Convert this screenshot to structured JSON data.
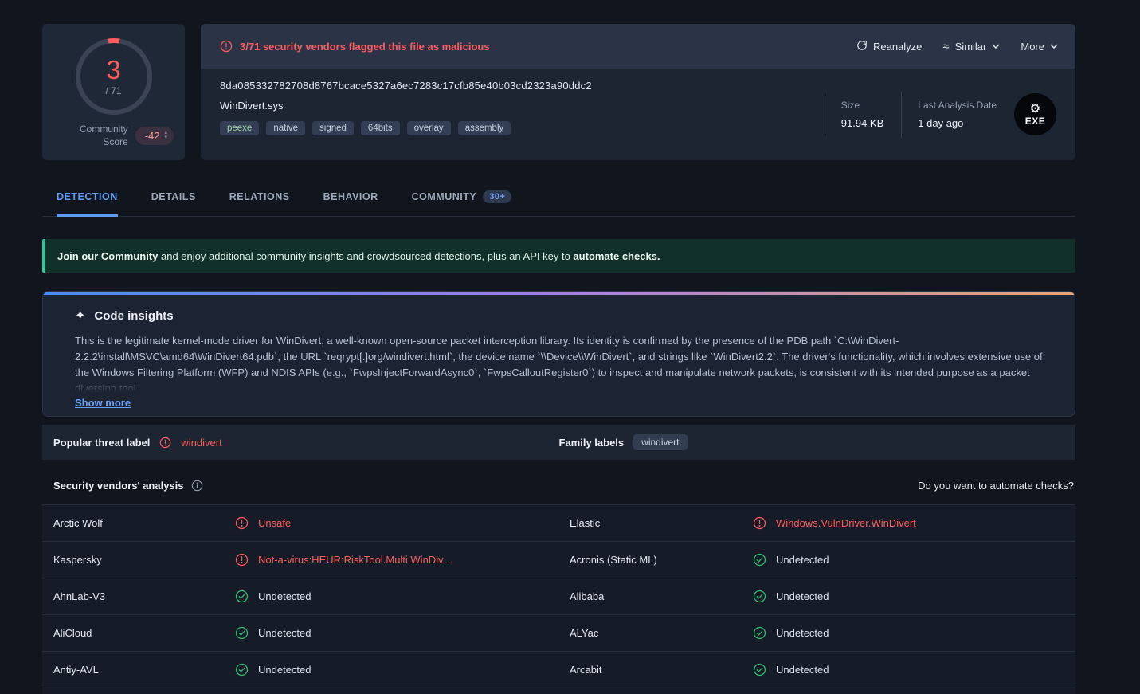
{
  "colors": {
    "red": "#ff5c5c",
    "green": "#2fbf71",
    "blue": "#619bf2",
    "teal": "#2ec89b",
    "tag-green": "#9fd6ad"
  },
  "score_widget": {
    "score": "3",
    "total": "/ 71",
    "community_label": "Community Score",
    "community_value": "-42"
  },
  "header": {
    "flag_message": "3/71 security vendors flagged this file as malicious",
    "reanalyze": "Reanalyze",
    "similar": "Similar",
    "more": "More",
    "hash": "8da085332782708d8767bcace5327a6ec7283c17cfb85e40b03cd2323a90ddc2",
    "filename": "WinDivert.sys",
    "tags": {
      "0": "peexe",
      "1": "native",
      "2": "signed",
      "3": "64bits",
      "4": "overlay",
      "5": "assembly"
    },
    "size_label": "Size",
    "size_value": "91.94 KB",
    "date_label": "Last Analysis Date",
    "date_value": "1 day ago",
    "filetype": "EXE"
  },
  "tabs": {
    "0": {
      "label": "DETECTION"
    },
    "1": {
      "label": "DETAILS"
    },
    "2": {
      "label": "RELATIONS"
    },
    "3": {
      "label": "BEHAVIOR"
    },
    "4": {
      "label": "COMMUNITY",
      "badge": "30+"
    }
  },
  "community_banner": {
    "link1": "Join our Community",
    "middle": " and enjoy additional community insights and crowdsourced detections, plus an API key to ",
    "link2": "automate checks."
  },
  "code_insights": {
    "title": "Code insights",
    "body": "This is the legitimate kernel-mode driver for WinDivert, a well-known open-source packet interception library. Its identity is confirmed by the presence of the PDB path `C:\\WinDivert-2.2.2\\install\\MSVC\\amd64\\WinDivert64.pdb`, the URL `reqrypt[.]org/windivert.html`, the device name `\\\\Device\\\\WinDivert`, and strings like `WinDivert2.2`. The driver's functionality, which involves extensive use of the Windows Filtering Platform (WFP) and NDIS APIs (e.g., `FwpsInjectForwardAsync0`, `FwpsCalloutRegister0`) to inspect and manipulate network packets, is consistent with its intended purpose as a packet diversion tool.",
    "show_more": "Show more"
  },
  "threat": {
    "popular_label": "Popular threat label",
    "popular_value": "windivert",
    "family_label": "Family labels",
    "family_value": "windivert"
  },
  "vendors": {
    "title": "Security vendors' analysis",
    "automate": "Do you want to automate checks?",
    "rows": [
      {
        "v1": "Arctic Wolf",
        "s1": "alert",
        "r1": "Unsafe",
        "v2": "Elastic",
        "s2": "alert",
        "r2": "Windows.VulnDriver.WinDivert"
      },
      {
        "v1": "Kaspersky",
        "s1": "alert",
        "r1": "Not-a-virus:HEUR:RiskTool.Multi.WinDiv…",
        "v2": "Acronis (Static ML)",
        "s2": "clean",
        "r2": "Undetected"
      },
      {
        "v1": "AhnLab-V3",
        "s1": "clean",
        "r1": "Undetected",
        "v2": "Alibaba",
        "s2": "clean",
        "r2": "Undetected"
      },
      {
        "v1": "AliCloud",
        "s1": "clean",
        "r1": "Undetected",
        "v2": "ALYac",
        "s2": "clean",
        "r2": "Undetected"
      },
      {
        "v1": "Antiy-AVL",
        "s1": "clean",
        "r1": "Undetected",
        "v2": "Arcabit",
        "s2": "clean",
        "r2": "Undetected"
      }
    ]
  }
}
